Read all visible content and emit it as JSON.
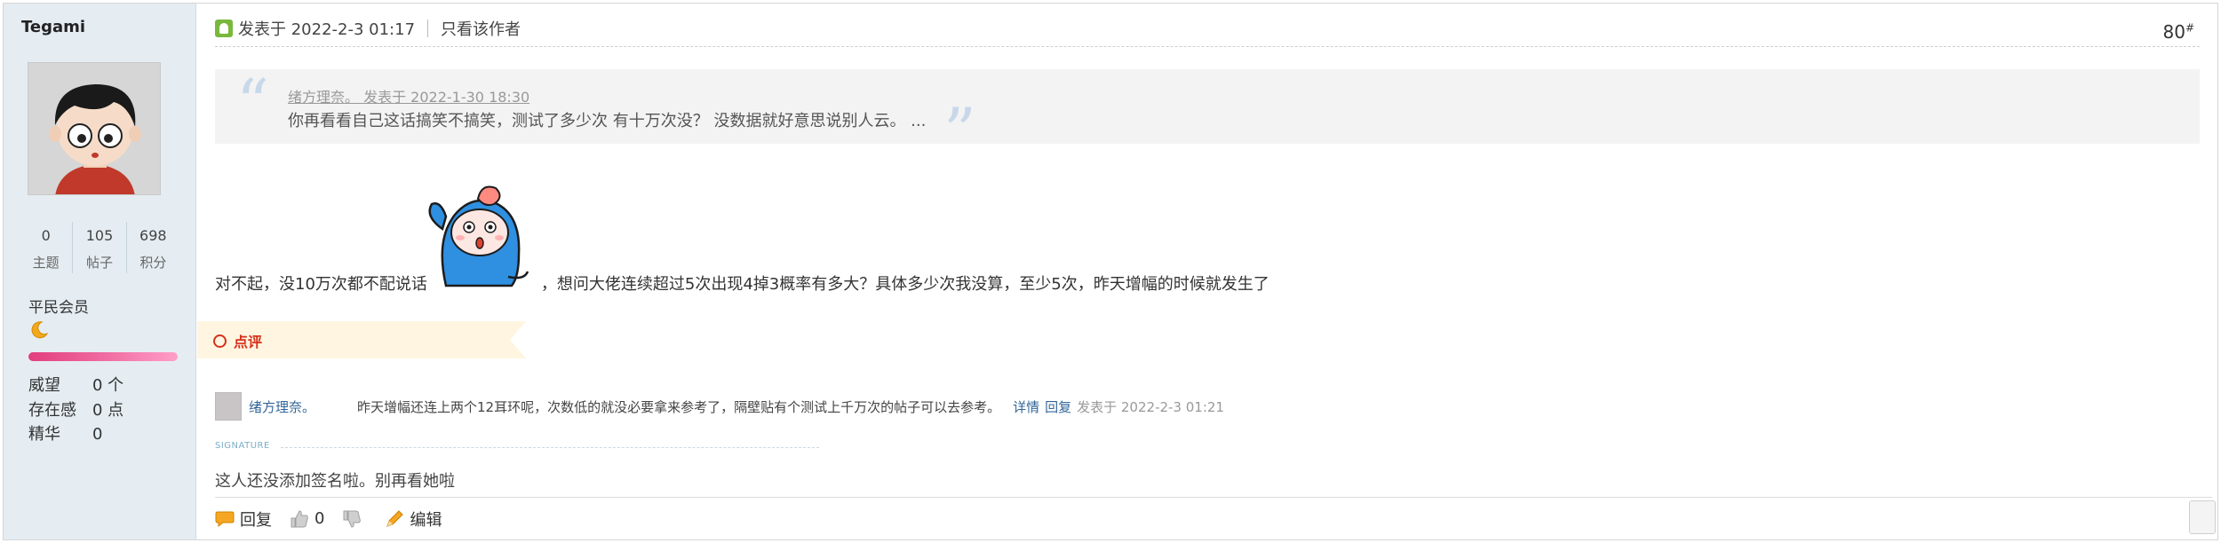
{
  "user": {
    "name": "Tegami",
    "stats": [
      {
        "value": "0",
        "label": "主题"
      },
      {
        "value": "105",
        "label": "帖子"
      },
      {
        "value": "698",
        "label": "积分"
      }
    ],
    "rank": "平民会员",
    "attributes": [
      {
        "key": "威望",
        "value": "0 个"
      },
      {
        "key": "存在感",
        "value": "0 点"
      },
      {
        "key": "精华",
        "value": "0"
      }
    ]
  },
  "post": {
    "posted_at": "发表于 2022-2-3 01:17",
    "only_author_link": "只看该作者",
    "floor": "80",
    "floor_mark": "#",
    "quote": {
      "author_line": "绪方理奈。 发表于 2022-1-30 18:30",
      "text": "你再看看自己这话搞笑不搞笑，测试了多少次 有十万次没？ 没数据就好意思说别人云。 ..."
    },
    "content_before": "对不起，没10万次都不配说话",
    "content_after": "，想问大佬连续超过5次出现4掉3概率有多大？具体多少次我没算，至少5次，昨天增幅的时候就发生了"
  },
  "comments": {
    "tab_label": "点评",
    "items": [
      {
        "user": "绪方理奈。",
        "text": "昨天增幅还连上两个12耳环呢，次数低的就没必要拿来参考了，隔壁贴有个测试上千万次的帖子可以去参考。",
        "details_link": "详情",
        "reply_link": "回复",
        "time": "发表于 2022-2-3 01:21"
      }
    ]
  },
  "signature": {
    "label": "SIGNATURE",
    "text": "这人还没添加签名啦。别再看她啦"
  },
  "footer": {
    "reply": "回复",
    "like_count": "0",
    "edit": "编辑"
  },
  "icons": {
    "online": "online-status-icon",
    "moon": "moon-rank-icon",
    "reply": "speech-bubble-icon",
    "like": "thumbs-up-icon",
    "dislike": "thumbs-down-icon",
    "edit": "pencil-icon"
  },
  "colors": {
    "sidebar_bg": "#e5edf2",
    "link": "#336699",
    "comment_accent": "#d6301a",
    "rank_bar": "#e23f7d"
  }
}
